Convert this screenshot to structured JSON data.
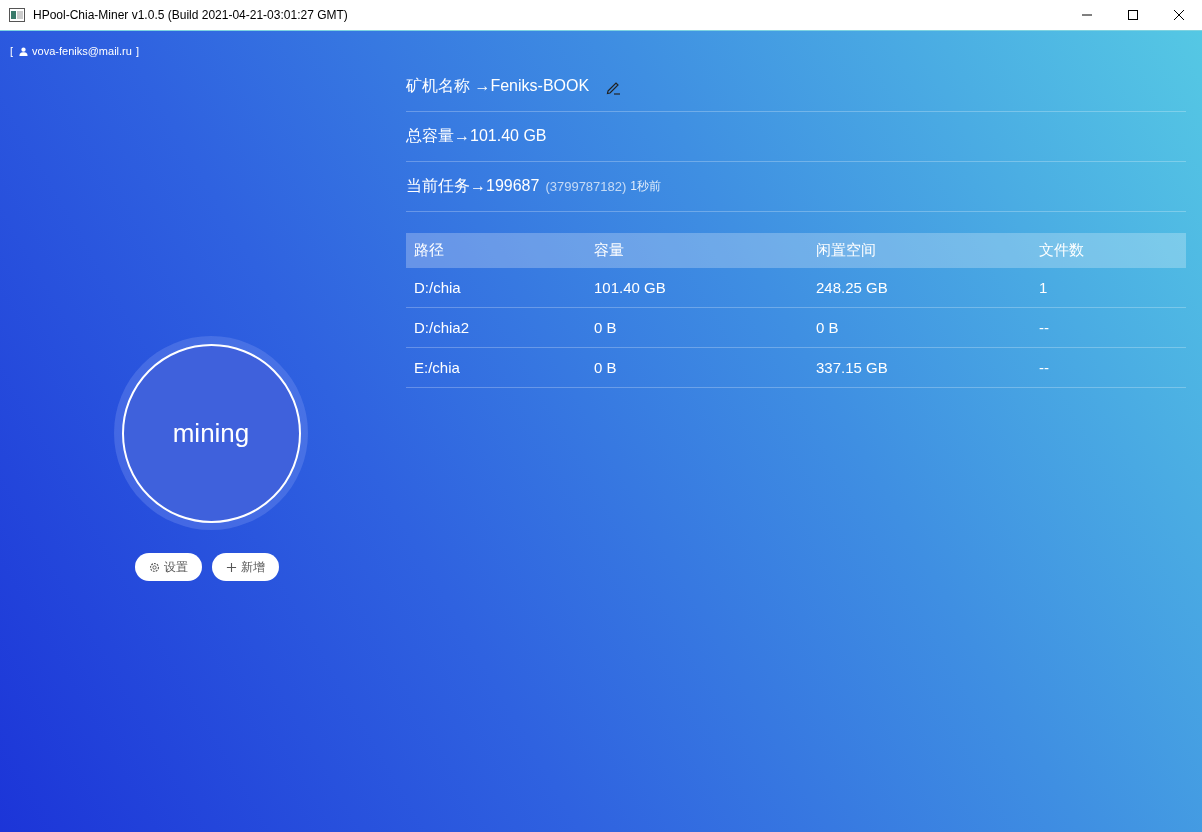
{
  "window": {
    "title": "HPool-Chia-Miner v1.0.5 (Build 2021-04-21-03:01:27 GMT)"
  },
  "user": {
    "open_bracket": "[",
    "email": "vova-feniks@mail.ru",
    "close_bracket": "]"
  },
  "status": {
    "label": "mining"
  },
  "buttons": [
    {
      "kind": "settings",
      "label": "设置"
    },
    {
      "kind": "add",
      "label": "新增"
    }
  ],
  "info": [
    {
      "kind": "name",
      "text": "矿机名称 →Feniks-BOOK"
    },
    {
      "kind": "plain",
      "text": "总容量→101.40 GB"
    },
    {
      "kind": "task",
      "text": "当前任务→199687",
      "detail": "(3799787182)",
      "time": "1秒前"
    }
  ],
  "table": {
    "columns": [
      "路径",
      "容量",
      "闲置空间",
      "文件数"
    ],
    "rows": [
      [
        "D:/chia",
        "101.40 GB",
        "248.25 GB",
        "1"
      ],
      [
        "D:/chia2",
        "0 B",
        "0 B",
        "--"
      ],
      [
        "E:/chia",
        "0 B",
        "337.15 GB",
        "--"
      ]
    ]
  }
}
